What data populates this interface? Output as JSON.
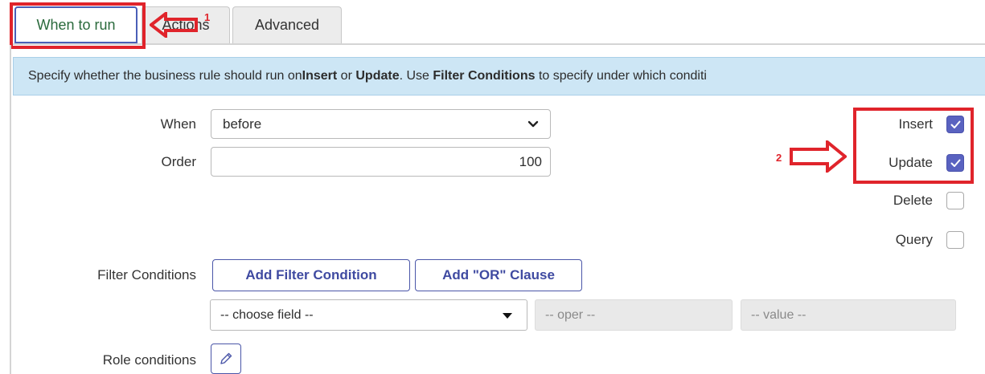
{
  "tabs": [
    {
      "label": "When to run"
    },
    {
      "label": "Actions"
    },
    {
      "label": "Advanced"
    }
  ],
  "annotations": {
    "num1": "1",
    "num2": "2"
  },
  "info": {
    "p1": "Specify whether the business rule should run on ",
    "b1": "Insert",
    "p2": " or ",
    "b2": "Update",
    "p3": ". Use ",
    "b3": "Filter Conditions",
    "p4": " to specify under which conditi"
  },
  "form": {
    "when_label": "When",
    "when_value": "before",
    "order_label": "Order",
    "order_value": "100",
    "filter_label": "Filter Conditions",
    "add_filter_label": "Add Filter Condition",
    "add_or_label": "Add \"OR\" Clause",
    "choose_field": "-- choose field --",
    "oper_placeholder": "-- oper --",
    "value_placeholder": "-- value --",
    "role_label": "Role conditions"
  },
  "checkboxes": [
    {
      "label": "Insert",
      "checked": true
    },
    {
      "label": "Update",
      "checked": true
    },
    {
      "label": "Delete",
      "checked": false
    },
    {
      "label": "Query",
      "checked": false
    }
  ],
  "colors": {
    "annotation": "#e0242b",
    "accent": "#5962c0",
    "info_bg": "#cde6f5"
  }
}
